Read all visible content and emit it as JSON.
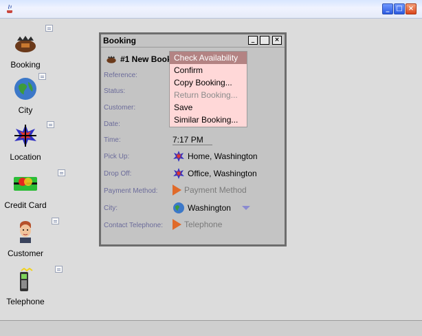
{
  "window": {
    "minimize": "_",
    "maximize": "□",
    "close": "×"
  },
  "launchers": [
    {
      "label": "Booking",
      "icon": "booking-icon"
    },
    {
      "label": "City",
      "icon": "globe-icon"
    },
    {
      "label": "Location",
      "icon": "location-icon"
    },
    {
      "label": "Credit Card",
      "icon": "credit-card-icon"
    },
    {
      "label": "Customer",
      "icon": "customer-icon"
    },
    {
      "label": "Telephone",
      "icon": "telephone-icon"
    }
  ],
  "booking_frame": {
    "title": "Booking",
    "header": "#1 New Booking",
    "fields": {
      "reference": "Reference:",
      "status": "Status:",
      "customer": "Customer:",
      "date": "Date:",
      "time": "Time:",
      "pickup": "Pick Up:",
      "dropoff": "Drop Off:",
      "payment_method": "Payment Method:",
      "city": "City:",
      "contact_telephone": "Contact Telephone:"
    },
    "values": {
      "time": "7:17 PM",
      "pickup": "Home, Washington",
      "dropoff": "Office, Washington",
      "payment_method": "Payment Method",
      "city": "Washington",
      "contact_telephone": "Telephone"
    }
  },
  "popup_menu": {
    "items": [
      {
        "label": "Check Availability",
        "state": "selected"
      },
      {
        "label": "Confirm",
        "state": "normal"
      },
      {
        "label": "Copy Booking...",
        "state": "normal"
      },
      {
        "label": "Return Booking...",
        "state": "disabled"
      },
      {
        "label": "Save",
        "state": "normal"
      },
      {
        "label": "Similar Booking...",
        "state": "normal"
      }
    ]
  },
  "colors": {
    "frame_border": "#6d6d6d",
    "popup_bg": "#ffd8d8",
    "popup_selected": "#b38383",
    "label_color": "#6b6b9a",
    "arrow_orange": "#e06a2a"
  }
}
